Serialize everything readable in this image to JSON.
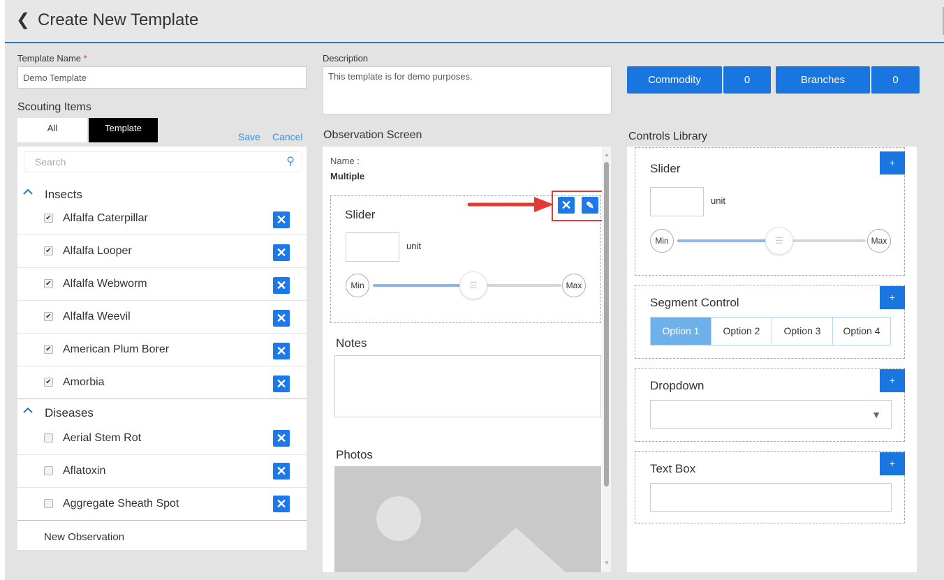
{
  "header": {
    "back_icon": "chevron-left-icon",
    "back_glyph": "❮",
    "title": "Create New Template"
  },
  "template_name": {
    "label": "Template Name",
    "required_mark": "*",
    "value": "Demo Template"
  },
  "description": {
    "label": "Description",
    "value": "This template is for demo purposes."
  },
  "counters": {
    "commodity_label": "Commodity",
    "commodity_count": "0",
    "branches_label": "Branches",
    "branches_count": "0"
  },
  "scouting": {
    "title": "Scouting Items",
    "tabs": [
      "All",
      "Template"
    ],
    "active_tab": "Template",
    "save_label": "Save",
    "cancel_label": "Cancel",
    "search_placeholder": "Search",
    "groups": [
      {
        "name": "Insects",
        "items": [
          {
            "label": "Alfalfa Caterpillar",
            "checked": true
          },
          {
            "label": "Alfalfa Looper",
            "checked": true
          },
          {
            "label": "Alfalfa Webworm",
            "checked": true
          },
          {
            "label": "Alfalfa Weevil",
            "checked": true
          },
          {
            "label": "American Plum Borer",
            "checked": true
          },
          {
            "label": "Amorbia",
            "checked": true
          }
        ]
      },
      {
        "name": "Diseases",
        "items": [
          {
            "label": "Aerial Stem Rot",
            "checked": false
          },
          {
            "label": "Aflatoxin",
            "checked": false
          },
          {
            "label": "Aggregate Sheath Spot",
            "checked": false
          }
        ]
      }
    ],
    "new_observation_label": "New Observation"
  },
  "observation": {
    "title": "Observation Screen",
    "name_label": "Name :",
    "name_value": "Multiple",
    "slider": {
      "title": "Slider",
      "unit": "unit",
      "min": "Min",
      "max": "Max",
      "level": 0.5
    },
    "notes_label": "Notes",
    "photos_label": "Photos"
  },
  "controls": {
    "title": "Controls Library",
    "plus": "+",
    "slider": {
      "title": "Slider",
      "unit": "unit",
      "min": "Min",
      "max": "Max",
      "level": 0.5
    },
    "segment": {
      "title": "Segment Control",
      "options": [
        "Option 1",
        "Option 2",
        "Option 3",
        "Option 4"
      ],
      "selected": "Option 1"
    },
    "dropdown": {
      "title": "Dropdown"
    },
    "textbox": {
      "title": "Text Box"
    }
  },
  "colors": {
    "accent": "#1976e0",
    "header_rule": "#2a79b8",
    "callout": "#e53935"
  }
}
